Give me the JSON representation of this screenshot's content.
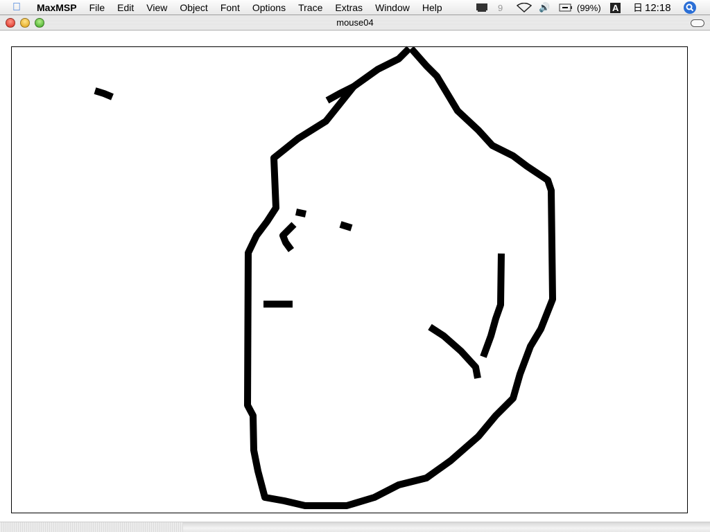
{
  "menubar": {
    "app": "MaxMSP",
    "items": [
      "File",
      "Edit",
      "View",
      "Object",
      "Font",
      "Options",
      "Trace",
      "Extras",
      "Window",
      "Help"
    ],
    "battery": "(99%)",
    "input_menu": "A",
    "calendar_glyph": "日",
    "clock": "12:18"
  },
  "window": {
    "title": "mouse04"
  },
  "colors": {
    "stroke": "#000000",
    "spotlight": "#2b6fd6"
  }
}
